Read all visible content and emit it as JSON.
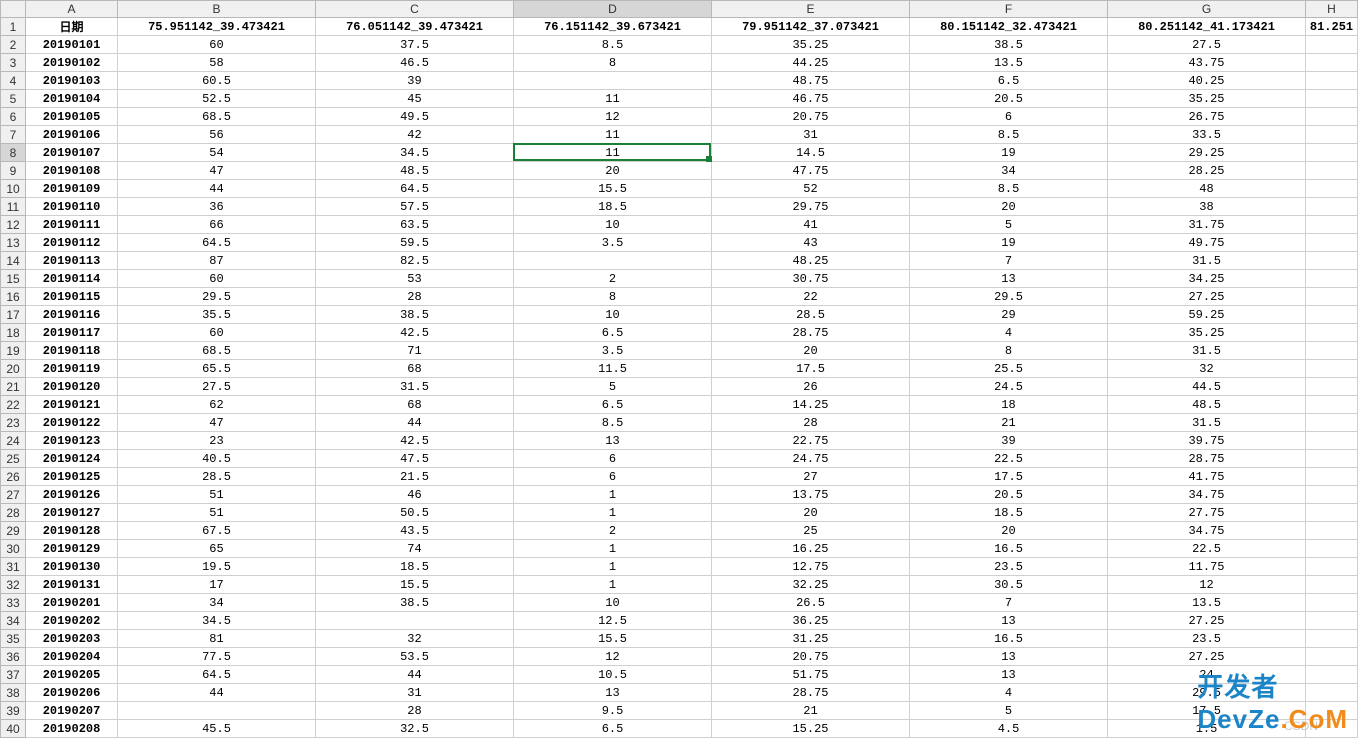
{
  "selection": {
    "row": 8,
    "col": "D"
  },
  "columns": [
    "A",
    "B",
    "C",
    "D",
    "E",
    "F",
    "G",
    "H"
  ],
  "col_widths": {
    "rowhdr": 26,
    "A": 92,
    "B": 198,
    "C": 198,
    "D": 198,
    "E": 198,
    "F": 198,
    "G": 198,
    "H": 52
  },
  "headers_row": {
    "A": "日期",
    "B": "75.951142_39.473421",
    "C": "76.051142_39.473421",
    "D": "76.151142_39.673421",
    "E": "79.951142_37.073421",
    "F": "80.151142_32.473421",
    "G": "80.251142_41.173421",
    "H": "81.251"
  },
  "rows": [
    {
      "n": 1
    },
    {
      "n": 2,
      "A": "20190101",
      "B": "60",
      "C": "37.5",
      "D": "8.5",
      "E": "35.25",
      "F": "38.5",
      "G": "27.5"
    },
    {
      "n": 3,
      "A": "20190102",
      "B": "58",
      "C": "46.5",
      "D": "8",
      "E": "44.25",
      "F": "13.5",
      "G": "43.75"
    },
    {
      "n": 4,
      "A": "20190103",
      "B": "60.5",
      "C": "39",
      "D": "",
      "E": "48.75",
      "F": "6.5",
      "G": "40.25"
    },
    {
      "n": 5,
      "A": "20190104",
      "B": "52.5",
      "C": "45",
      "D": "11",
      "E": "46.75",
      "F": "20.5",
      "G": "35.25"
    },
    {
      "n": 6,
      "A": "20190105",
      "B": "68.5",
      "C": "49.5",
      "D": "12",
      "E": "20.75",
      "F": "6",
      "G": "26.75"
    },
    {
      "n": 7,
      "A": "20190106",
      "B": "56",
      "C": "42",
      "D": "11",
      "E": "31",
      "F": "8.5",
      "G": "33.5"
    },
    {
      "n": 8,
      "A": "20190107",
      "B": "54",
      "C": "34.5",
      "D": "11",
      "E": "14.5",
      "F": "19",
      "G": "29.25"
    },
    {
      "n": 9,
      "A": "20190108",
      "B": "47",
      "C": "48.5",
      "D": "20",
      "E": "47.75",
      "F": "34",
      "G": "28.25"
    },
    {
      "n": 10,
      "A": "20190109",
      "B": "44",
      "C": "64.5",
      "D": "15.5",
      "E": "52",
      "F": "8.5",
      "G": "48"
    },
    {
      "n": 11,
      "A": "20190110",
      "B": "36",
      "C": "57.5",
      "D": "18.5",
      "E": "29.75",
      "F": "20",
      "G": "38"
    },
    {
      "n": 12,
      "A": "20190111",
      "B": "66",
      "C": "63.5",
      "D": "10",
      "E": "41",
      "F": "5",
      "G": "31.75"
    },
    {
      "n": 13,
      "A": "20190112",
      "B": "64.5",
      "C": "59.5",
      "D": "3.5",
      "E": "43",
      "F": "19",
      "G": "49.75"
    },
    {
      "n": 14,
      "A": "20190113",
      "B": "87",
      "C": "82.5",
      "D": "",
      "E": "48.25",
      "F": "7",
      "G": "31.5"
    },
    {
      "n": 15,
      "A": "20190114",
      "B": "60",
      "C": "53",
      "D": "2",
      "E": "30.75",
      "F": "13",
      "G": "34.25"
    },
    {
      "n": 16,
      "A": "20190115",
      "B": "29.5",
      "C": "28",
      "D": "8",
      "E": "22",
      "F": "29.5",
      "G": "27.25"
    },
    {
      "n": 17,
      "A": "20190116",
      "B": "35.5",
      "C": "38.5",
      "D": "10",
      "E": "28.5",
      "F": "29",
      "G": "59.25"
    },
    {
      "n": 18,
      "A": "20190117",
      "B": "60",
      "C": "42.5",
      "D": "6.5",
      "E": "28.75",
      "F": "4",
      "G": "35.25"
    },
    {
      "n": 19,
      "A": "20190118",
      "B": "68.5",
      "C": "71",
      "D": "3.5",
      "E": "20",
      "F": "8",
      "G": "31.5"
    },
    {
      "n": 20,
      "A": "20190119",
      "B": "65.5",
      "C": "68",
      "D": "11.5",
      "E": "17.5",
      "F": "25.5",
      "G": "32"
    },
    {
      "n": 21,
      "A": "20190120",
      "B": "27.5",
      "C": "31.5",
      "D": "5",
      "E": "26",
      "F": "24.5",
      "G": "44.5"
    },
    {
      "n": 22,
      "A": "20190121",
      "B": "62",
      "C": "68",
      "D": "6.5",
      "E": "14.25",
      "F": "18",
      "G": "48.5"
    },
    {
      "n": 23,
      "A": "20190122",
      "B": "47",
      "C": "44",
      "D": "8.5",
      "E": "28",
      "F": "21",
      "G": "31.5"
    },
    {
      "n": 24,
      "A": "20190123",
      "B": "23",
      "C": "42.5",
      "D": "13",
      "E": "22.75",
      "F": "39",
      "G": "39.75"
    },
    {
      "n": 25,
      "A": "20190124",
      "B": "40.5",
      "C": "47.5",
      "D": "6",
      "E": "24.75",
      "F": "22.5",
      "G": "28.75"
    },
    {
      "n": 26,
      "A": "20190125",
      "B": "28.5",
      "C": "21.5",
      "D": "6",
      "E": "27",
      "F": "17.5",
      "G": "41.75"
    },
    {
      "n": 27,
      "A": "20190126",
      "B": "51",
      "C": "46",
      "D": "1",
      "E": "13.75",
      "F": "20.5",
      "G": "34.75"
    },
    {
      "n": 28,
      "A": "20190127",
      "B": "51",
      "C": "50.5",
      "D": "1",
      "E": "20",
      "F": "18.5",
      "G": "27.75"
    },
    {
      "n": 29,
      "A": "20190128",
      "B": "67.5",
      "C": "43.5",
      "D": "2",
      "E": "25",
      "F": "20",
      "G": "34.75"
    },
    {
      "n": 30,
      "A": "20190129",
      "B": "65",
      "C": "74",
      "D": "1",
      "E": "16.25",
      "F": "16.5",
      "G": "22.5"
    },
    {
      "n": 31,
      "A": "20190130",
      "B": "19.5",
      "C": "18.5",
      "D": "1",
      "E": "12.75",
      "F": "23.5",
      "G": "11.75"
    },
    {
      "n": 32,
      "A": "20190131",
      "B": "17",
      "C": "15.5",
      "D": "1",
      "E": "32.25",
      "F": "30.5",
      "G": "12"
    },
    {
      "n": 33,
      "A": "20190201",
      "B": "34",
      "C": "38.5",
      "D": "10",
      "E": "26.5",
      "F": "7",
      "G": "13.5"
    },
    {
      "n": 34,
      "A": "20190202",
      "B": "34.5",
      "C": "",
      "D": "12.5",
      "E": "36.25",
      "F": "13",
      "G": "27.25"
    },
    {
      "n": 35,
      "A": "20190203",
      "B": "81",
      "C": "32",
      "D": "15.5",
      "E": "31.25",
      "F": "16.5",
      "G": "23.5"
    },
    {
      "n": 36,
      "A": "20190204",
      "B": "77.5",
      "C": "53.5",
      "D": "12",
      "E": "20.75",
      "F": "13",
      "G": "27.25"
    },
    {
      "n": 37,
      "A": "20190205",
      "B": "64.5",
      "C": "44",
      "D": "10.5",
      "E": "51.75",
      "F": "13",
      "G": "24"
    },
    {
      "n": 38,
      "A": "20190206",
      "B": "44",
      "C": "31",
      "D": "13",
      "E": "28.75",
      "F": "4",
      "G": "29.5"
    },
    {
      "n": 39,
      "A": "20190207",
      "B": "",
      "C": "28",
      "D": "9.5",
      "E": "21",
      "F": "5",
      "G": "17.5"
    },
    {
      "n": 40,
      "A": "20190208",
      "B": "45.5",
      "C": "32.5",
      "D": "6.5",
      "E": "15.25",
      "F": "4.5",
      "G": "1.5"
    }
  ],
  "watermark_small": "CSDN",
  "watermark_large_a": "开发者",
  "watermark_large_b": "DevZe",
  "watermark_large_c": ".CoM"
}
